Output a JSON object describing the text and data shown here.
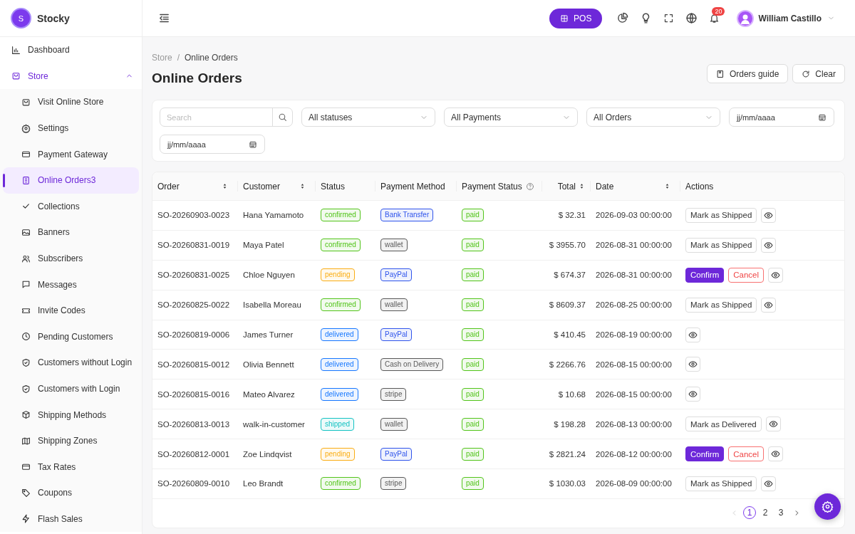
{
  "brand": {
    "name": "Stocky",
    "logo_letter": "S"
  },
  "topbar": {
    "pos_label": "POS",
    "notification_count": "20",
    "user_name": "William Castillo"
  },
  "sidebar": {
    "items": [
      {
        "label": "Dashboard"
      },
      {
        "label": "Store",
        "expanded": true,
        "children": [
          {
            "label": "Visit Online Store",
            "selected": false
          },
          {
            "label": "Settings",
            "selected": false
          },
          {
            "label": "Payment Gateway",
            "selected": false
          },
          {
            "label": "Online Orders3",
            "selected": true
          },
          {
            "label": "Collections",
            "selected": false
          },
          {
            "label": "Banners",
            "selected": false
          },
          {
            "label": "Subscribers",
            "selected": false
          },
          {
            "label": "Messages",
            "selected": false
          },
          {
            "label": "Invite Codes",
            "selected": false
          },
          {
            "label": "Pending Customers",
            "selected": false
          },
          {
            "label": "Customers without Login",
            "selected": false
          },
          {
            "label": "Customers with Login",
            "selected": false
          },
          {
            "label": "Shipping Methods",
            "selected": false
          },
          {
            "label": "Shipping Zones",
            "selected": false
          },
          {
            "label": "Tax Rates",
            "selected": false
          },
          {
            "label": "Coupons",
            "selected": false
          },
          {
            "label": "Flash Sales",
            "selected": false
          }
        ]
      }
    ]
  },
  "breadcrumb": [
    "Store",
    "Online Orders"
  ],
  "breadcrumb_separator": "/",
  "page_title": "Online Orders",
  "header_buttons": [
    "Orders guide",
    "Clear"
  ],
  "filters": {
    "search": {
      "placeholder": "Search"
    },
    "selects": [
      "All statuses",
      "All Payments",
      "All Orders"
    ],
    "dates": [
      {
        "placeholder": "jj/mm/aaaa"
      },
      {
        "placeholder": "jj/mm/aaaa"
      }
    ]
  },
  "table": {
    "columns": [
      {
        "label": "Order",
        "sortable": true,
        "help": false
      },
      {
        "label": "Customer",
        "sortable": true,
        "help": false
      },
      {
        "label": "Status",
        "sortable": false,
        "help": false
      },
      {
        "label": "Payment Method",
        "sortable": false,
        "help": false
      },
      {
        "label": "Payment Status",
        "sortable": false,
        "help": true
      },
      {
        "label": "Total",
        "sortable": true,
        "help": false
      },
      {
        "label": "Date",
        "sortable": true,
        "help": false
      },
      {
        "label": "Actions",
        "sortable": false,
        "help": false
      }
    ],
    "rows": [
      {
        "order": "SO-20260903-0023",
        "customer": "Hana Yamamoto",
        "status": {
          "label": "confirmed",
          "color": "#52c41a"
        },
        "payment_method": {
          "label": "Bank Transfer",
          "color": "#2f54eb"
        },
        "payment_status": {
          "label": "paid",
          "color": "#52c41a"
        },
        "total": "$ 32.31",
        "date": "2026-09-03 00:00:00",
        "actions": [
          {
            "label": "Mark as Shipped",
            "kind": "default"
          }
        ]
      },
      {
        "order": "SO-20260831-0019",
        "customer": "Maya Patel",
        "status": {
          "label": "confirmed",
          "color": "#52c41a"
        },
        "payment_method": {
          "label": "wallet",
          "color": "#595959"
        },
        "payment_status": {
          "label": "paid",
          "color": "#52c41a"
        },
        "total": "$ 3955.70",
        "date": "2026-08-31 00:00:00",
        "actions": [
          {
            "label": "Mark as Shipped",
            "kind": "default"
          }
        ]
      },
      {
        "order": "SO-20260831-0025",
        "customer": "Chloe Nguyen",
        "status": {
          "label": "pending",
          "color": "#faad14"
        },
        "payment_method": {
          "label": "PayPal",
          "color": "#2f54eb"
        },
        "payment_status": {
          "label": "paid",
          "color": "#52c41a"
        },
        "total": "$ 674.37",
        "date": "2026-08-31 00:00:00",
        "actions": [
          {
            "label": "Confirm",
            "kind": "primary"
          },
          {
            "label": "Cancel",
            "kind": "danger"
          }
        ]
      },
      {
        "order": "SO-20260825-0022",
        "customer": "Isabella Moreau",
        "status": {
          "label": "confirmed",
          "color": "#52c41a"
        },
        "payment_method": {
          "label": "wallet",
          "color": "#595959"
        },
        "payment_status": {
          "label": "paid",
          "color": "#52c41a"
        },
        "total": "$ 8609.37",
        "date": "2026-08-25 00:00:00",
        "actions": [
          {
            "label": "Mark as Shipped",
            "kind": "default"
          }
        ]
      },
      {
        "order": "SO-20260819-0006",
        "customer": "James Turner",
        "status": {
          "label": "delivered",
          "color": "#1677ff"
        },
        "payment_method": {
          "label": "PayPal",
          "color": "#2f54eb"
        },
        "payment_status": {
          "label": "paid",
          "color": "#52c41a"
        },
        "total": "$ 410.45",
        "date": "2026-08-19 00:00:00"
      },
      {
        "order": "SO-20260815-0012",
        "customer": "Olivia Bennett",
        "status": {
          "label": "delivered",
          "color": "#1677ff"
        },
        "payment_method": {
          "label": "Cash on Delivery",
          "color": "#595959"
        },
        "payment_status": {
          "label": "paid",
          "color": "#52c41a"
        },
        "total": "$ 2266.76",
        "date": "2026-08-15 00:00:00"
      },
      {
        "order": "SO-20260815-0016",
        "customer": "Mateo Alvarez",
        "status": {
          "label": "delivered",
          "color": "#1677ff"
        },
        "payment_method": {
          "label": "stripe",
          "color": "#595959"
        },
        "payment_status": {
          "label": "paid",
          "color": "#52c41a"
        },
        "total": "$ 10.68",
        "date": "2026-08-15 00:00:00"
      },
      {
        "order": "SO-20260813-0013",
        "customer": "walk-in-customer",
        "status": {
          "label": "shipped",
          "color": "#13c2c2"
        },
        "payment_method": {
          "label": "wallet",
          "color": "#595959"
        },
        "payment_status": {
          "label": "paid",
          "color": "#52c41a"
        },
        "total": "$ 198.28",
        "date": "2026-08-13 00:00:00",
        "actions": [
          {
            "label": "Mark as Delivered",
            "kind": "default"
          }
        ]
      },
      {
        "order": "SO-20260812-0001",
        "customer": "Zoe Lindqvist",
        "status": {
          "label": "pending",
          "color": "#faad14"
        },
        "payment_method": {
          "label": "PayPal",
          "color": "#2f54eb"
        },
        "payment_status": {
          "label": "paid",
          "color": "#52c41a"
        },
        "total": "$ 2821.24",
        "date": "2026-08-12 00:00:00",
        "actions": [
          {
            "label": "Confirm",
            "kind": "primary"
          },
          {
            "label": "Cancel",
            "kind": "danger"
          }
        ]
      },
      {
        "order": "SO-20260809-0010",
        "customer": "Leo Brandt",
        "status": {
          "label": "confirmed",
          "color": "#52c41a"
        },
        "payment_method": {
          "label": "stripe",
          "color": "#595959"
        },
        "payment_status": {
          "label": "paid",
          "color": "#52c41a"
        },
        "total": "$ 1030.03",
        "date": "2026-08-09 00:00:00",
        "actions": [
          {
            "label": "Mark as Shipped",
            "kind": "default"
          }
        ]
      }
    ]
  },
  "pagination": {
    "prev_disabled": true,
    "pages": [
      {
        "label": "1",
        "selected": true
      },
      {
        "label": "2",
        "selected": false
      },
      {
        "label": "3",
        "selected": false
      }
    ]
  }
}
